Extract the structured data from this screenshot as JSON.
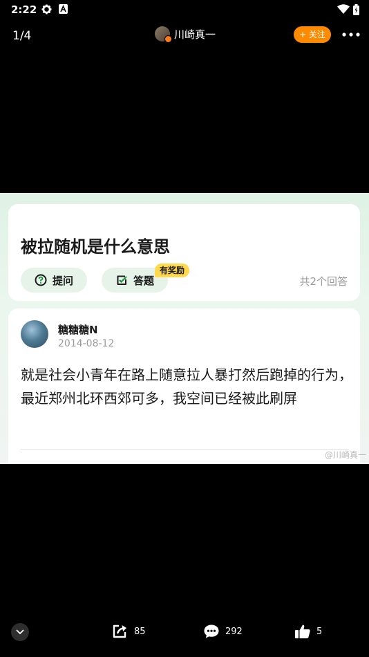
{
  "status_bar": {
    "time": "2:22",
    "icons": [
      "gear-icon",
      "app-a-icon",
      "wifi-icon",
      "battery-icon"
    ]
  },
  "top_bar": {
    "counter": "1/4",
    "author_name": "川崎真一",
    "follow_label": "+ 关注",
    "more_icon": "more-dots-icon"
  },
  "screenshot": {
    "question": {
      "title": "被拉随机是什么意思",
      "ask_label": "提问",
      "answer_label": "答题",
      "reward_badge": "有奖励",
      "answers_count": "共2个回答"
    },
    "answer": {
      "author": "糖糖糖N",
      "date": "2014-08-12",
      "text": "就是社会小青年在路上随意拉人暴打然后跑掉的行为，最近郑州北环西郊可多，我空间已经被此刷屏"
    },
    "watermark": "@川崎真一"
  },
  "bottom_bar": {
    "share_count": "85",
    "comment_count": "292",
    "like_count": "5"
  },
  "colors": {
    "accent": "#ff8a00",
    "pill_bg": "#e6f3e9",
    "reward": "#ffd84d",
    "green_icon": "#1f8f3a"
  }
}
